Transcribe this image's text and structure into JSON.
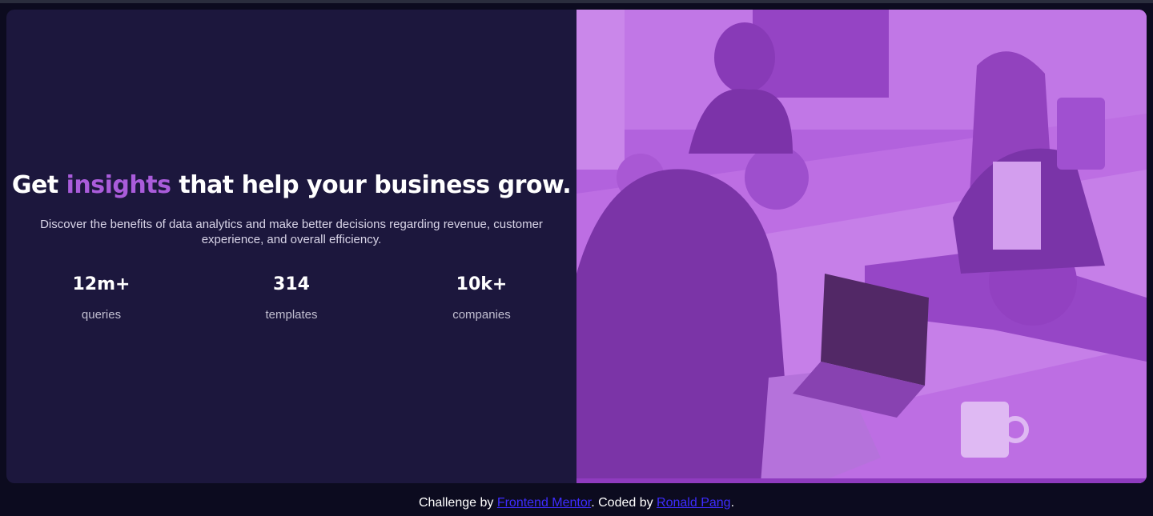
{
  "hero": {
    "headline_pre": "Get ",
    "headline_accent": "insights",
    "headline_post": " that help your business grow.",
    "description": "Discover the benefits of data analytics and make better decisions regarding revenue, customer experience, and overall efficiency."
  },
  "stats": [
    {
      "value": "12m+",
      "label": "queries"
    },
    {
      "value": "314",
      "label": "templates"
    },
    {
      "value": "10k+",
      "label": "companies"
    }
  ],
  "footer": {
    "prefix": "Challenge by ",
    "link1": "Frontend Mentor",
    "middle": ". Coded by ",
    "link2": "Ronald Pang",
    "suffix": "."
  },
  "colors": {
    "background": "#0c0b1f",
    "card": "#1c173d",
    "accent": "#aa5cdb",
    "image_overlay": "#a14bd0",
    "link": "#3e2cff"
  },
  "image": {
    "name": "team-working-photo"
  }
}
